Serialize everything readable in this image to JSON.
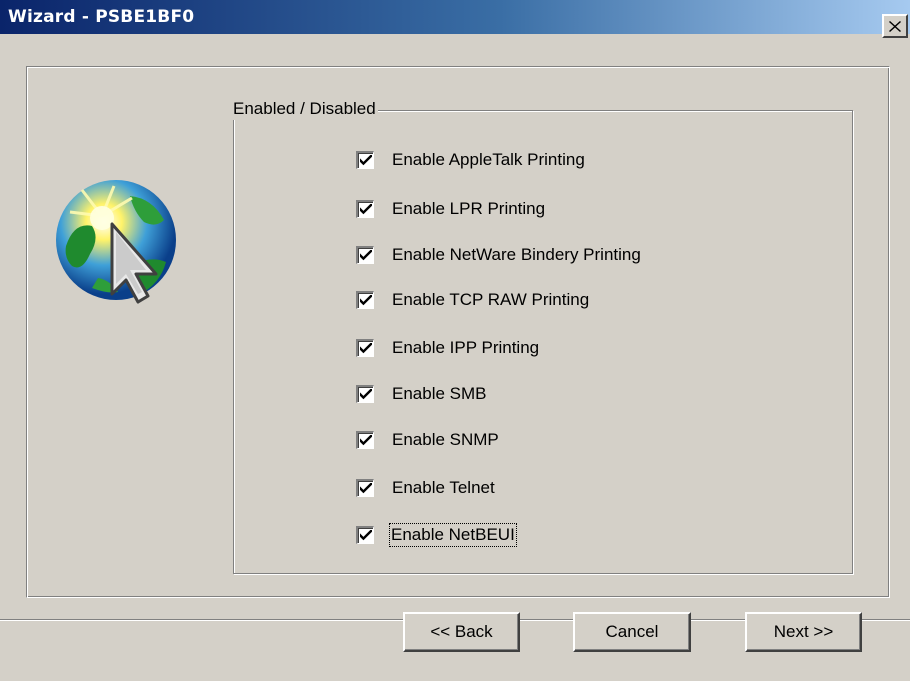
{
  "window": {
    "title": "Wizard - PSBE1BF0"
  },
  "group": {
    "legend": "Enabled / Disabled"
  },
  "options": [
    {
      "label": "Enable AppleTalk Printing",
      "checked": true
    },
    {
      "label": "Enable LPR Printing",
      "checked": true
    },
    {
      "label": "Enable NetWare Bindery Printing",
      "checked": true
    },
    {
      "label": "Enable TCP RAW Printing",
      "checked": true
    },
    {
      "label": "Enable IPP Printing",
      "checked": true
    },
    {
      "label": "Enable SMB",
      "checked": true
    },
    {
      "label": "Enable SNMP",
      "checked": true
    },
    {
      "label": "Enable Telnet",
      "checked": true
    },
    {
      "label": "Enable NetBEUI",
      "checked": true,
      "focused": true
    }
  ],
  "buttons": {
    "back": "<< Back",
    "cancel": "Cancel",
    "next": "Next >>"
  },
  "icons": {
    "close": "close-icon",
    "wizard": "wizard-globe-cursor-icon",
    "checkmark": "checkmark-icon"
  },
  "colors": {
    "title_start": "#0a246a",
    "title_end": "#a6caf0",
    "face": "#d4d0c8"
  }
}
